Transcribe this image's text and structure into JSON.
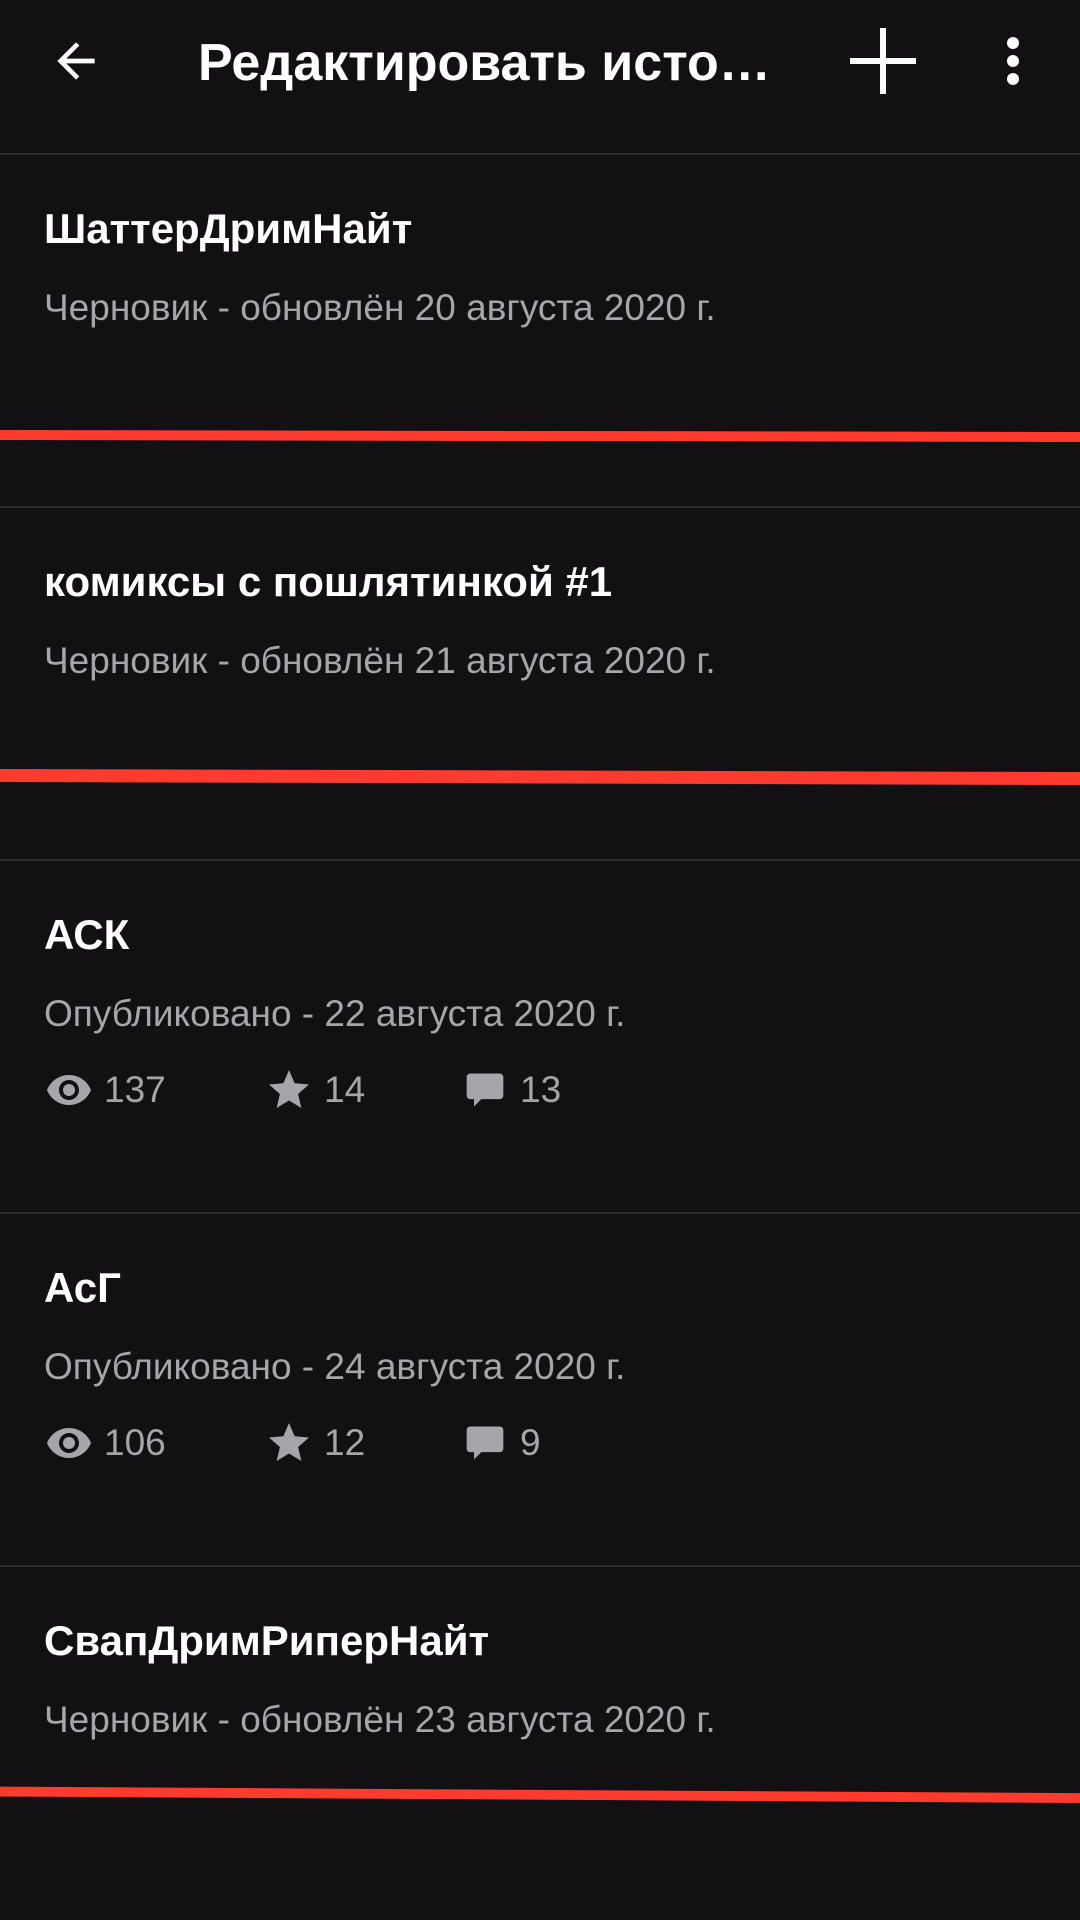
{
  "header": {
    "title": "Редактировать исто…",
    "back_icon": "arrow-left-icon",
    "add_icon": "plus-icon",
    "more_icon": "more-vertical-icon"
  },
  "stories": [
    {
      "title": "ШаттерДримНайт",
      "status": "Черновик - обновлён 20 августа 2020 г."
    },
    {
      "title": "комиксы с пошлятинкой #1",
      "status": "Черновик - обновлён 21 августа 2020 г."
    },
    {
      "title": "АСК",
      "status": "Опубликовано - 22 августа 2020 г.",
      "stats": {
        "views": "137",
        "votes": "14",
        "comments": "13"
      }
    },
    {
      "title": "АсГ",
      "status": "Опубликовано - 24 августа 2020 г.",
      "stats": {
        "views": "106",
        "votes": "12",
        "comments": "9"
      }
    },
    {
      "title": "СвапДримРиперНайт",
      "status": "Черновик - обновлён 23 августа 2020 г."
    }
  ],
  "colors": {
    "background": "#121013",
    "divider": "#2c2b2f",
    "secondary_text": "#a7a5aa",
    "annotation_red": "#ff3b30"
  }
}
